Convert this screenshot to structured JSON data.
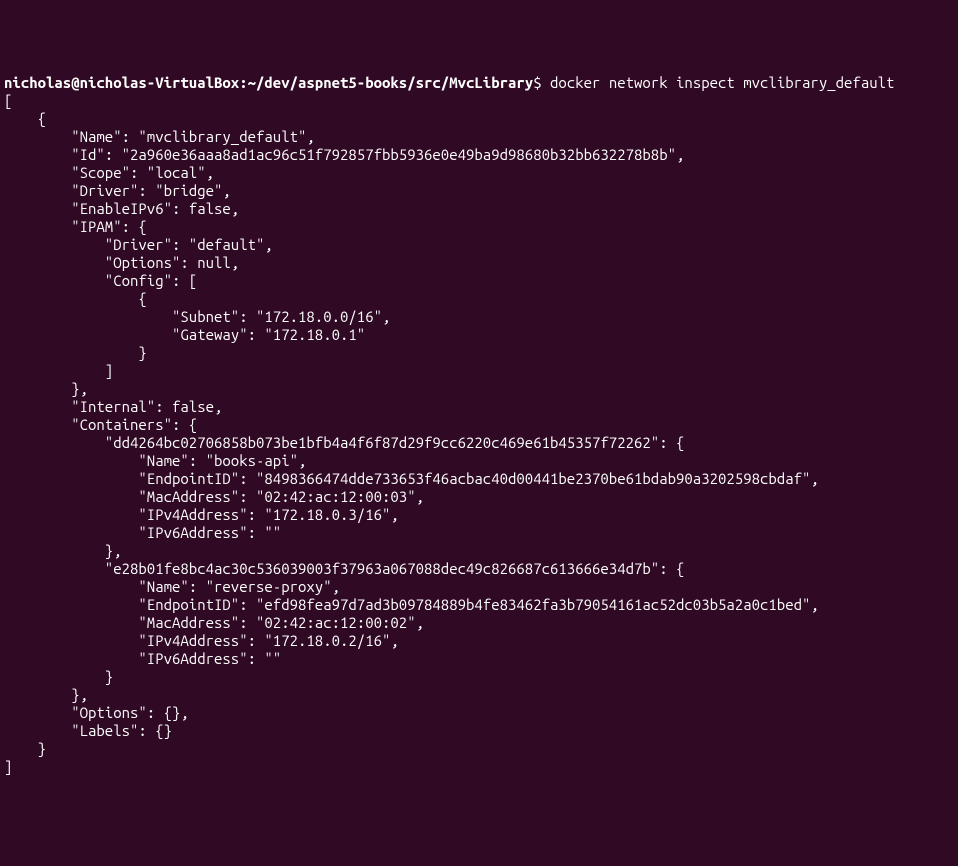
{
  "prompt": {
    "user_host": "nicholas@nicholas-VirtualBox",
    "separator1": ":",
    "path": "~/dev/aspnet5-books/src/MvcLibrary",
    "dollar": "$",
    "command": "docker network inspect mvclibrary_default"
  },
  "output_lines": [
    "[",
    "    {",
    "        \"Name\": \"mvclibrary_default\",",
    "        \"Id\": \"2a960e36aaa8ad1ac96c51f792857fbb5936e0e49ba9d98680b32bb632278b8b\",",
    "        \"Scope\": \"local\",",
    "        \"Driver\": \"bridge\",",
    "        \"EnableIPv6\": false,",
    "        \"IPAM\": {",
    "            \"Driver\": \"default\",",
    "            \"Options\": null,",
    "            \"Config\": [",
    "                {",
    "                    \"Subnet\": \"172.18.0.0/16\",",
    "                    \"Gateway\": \"172.18.0.1\"",
    "                }",
    "            ]",
    "        },",
    "        \"Internal\": false,",
    "        \"Containers\": {",
    "            \"dd4264bc02706858b073be1bfb4a4f6f87d29f9cc6220c469e61b45357f72262\": {",
    "                \"Name\": \"books-api\",",
    "                \"EndpointID\": \"8498366474dde733653f46acbac40d00441be2370be61bdab90a3202598cbdaf\",",
    "                \"MacAddress\": \"02:42:ac:12:00:03\",",
    "                \"IPv4Address\": \"172.18.0.3/16\",",
    "                \"IPv6Address\": \"\"",
    "            },",
    "            \"e28b01fe8bc4ac30c536039003f37963a067088dec49c826687c613666e34d7b\": {",
    "                \"Name\": \"reverse-proxy\",",
    "                \"EndpointID\": \"efd98fea97d7ad3b09784889b4fe83462fa3b79054161ac52dc03b5a2a0c1bed\",",
    "                \"MacAddress\": \"02:42:ac:12:00:02\",",
    "                \"IPv4Address\": \"172.18.0.2/16\",",
    "                \"IPv6Address\": \"\"",
    "            }",
    "        },",
    "        \"Options\": {},",
    "        \"Labels\": {}",
    "    }",
    "]"
  ]
}
